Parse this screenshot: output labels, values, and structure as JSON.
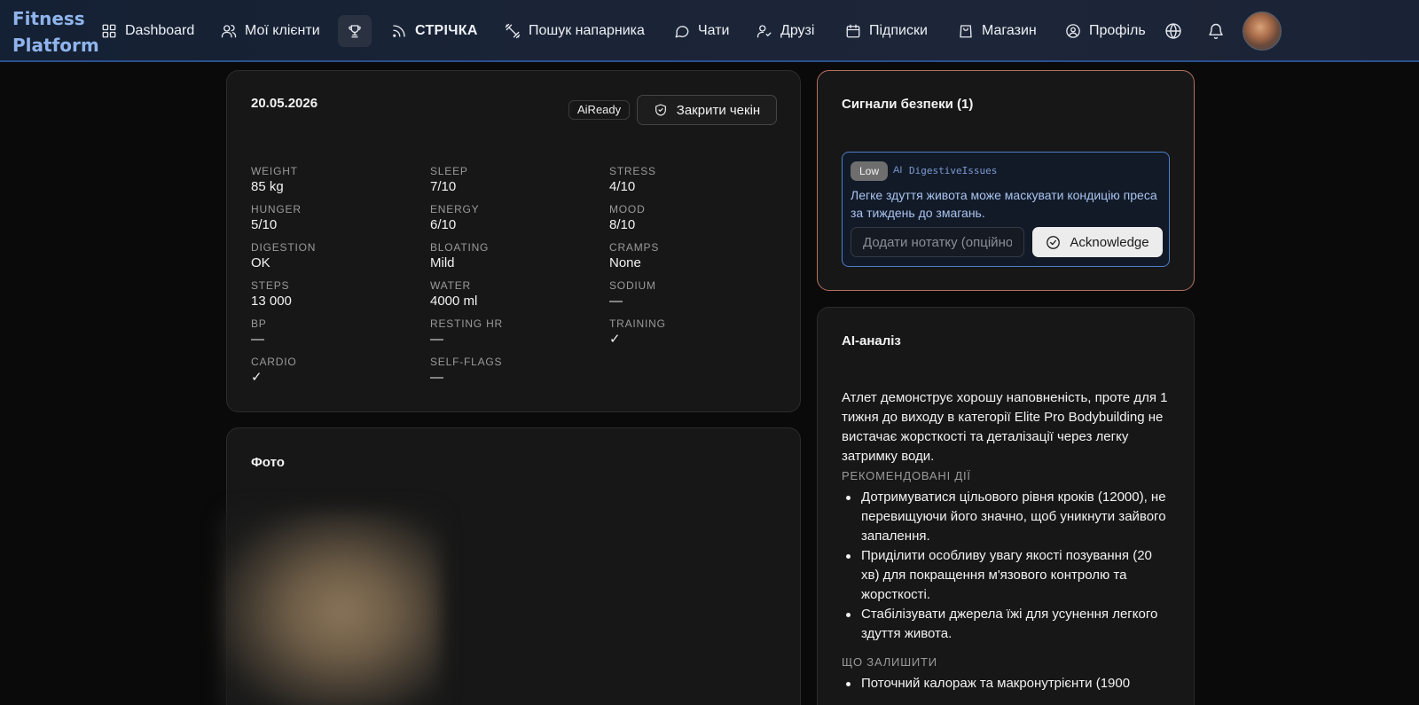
{
  "nav": {
    "brand_line1": "Fitness",
    "brand_line2": "Platform",
    "items": {
      "dashboard": "Dashboard",
      "clients": "Мої клієнти",
      "feed": "СТРІЧКА",
      "partner": "Пошук напарника",
      "chats": "Чати",
      "friends": "Друзі",
      "subscriptions": "Підписки",
      "shop": "Магазин",
      "profile": "Профіль"
    }
  },
  "checkin": {
    "date": "20.05.2026",
    "status_badge": "AiReady",
    "close_label": "Закрити чекін",
    "metrics": {
      "weight": {
        "label": "WEIGHT",
        "value": "85 kg"
      },
      "sleep": {
        "label": "SLEEP",
        "value": "7/10"
      },
      "stress": {
        "label": "STRESS",
        "value": "4/10"
      },
      "hunger": {
        "label": "HUNGER",
        "value": "5/10"
      },
      "energy": {
        "label": "ENERGY",
        "value": "6/10"
      },
      "mood": {
        "label": "MOOD",
        "value": "8/10"
      },
      "digestion": {
        "label": "DIGESTION",
        "value": "OK"
      },
      "bloating": {
        "label": "BLOATING",
        "value": "Mild"
      },
      "cramps": {
        "label": "CRAMPS",
        "value": "None"
      },
      "steps": {
        "label": "STEPS",
        "value": "13 000"
      },
      "water": {
        "label": "WATER",
        "value": "4000 ml"
      },
      "sodium": {
        "label": "SODIUM",
        "value": "—"
      },
      "bp": {
        "label": "BP",
        "value": "—"
      },
      "resting_hr": {
        "label": "RESTING HR",
        "value": "—"
      },
      "training": {
        "label": "TRAINING",
        "value": "✓"
      },
      "cardio": {
        "label": "CARDIO",
        "value": "✓"
      },
      "self_flags": {
        "label": "SELF-FLAGS",
        "value": "—"
      }
    }
  },
  "photos": {
    "title": "Фото"
  },
  "safety": {
    "title": "Сигнали безпеки (1)",
    "signal": {
      "severity": "Low",
      "source": "AI",
      "code": "DigestiveIssues",
      "text": "Легке здуття живота може маскувати кондицію преса за тиждень до змагань.",
      "note_placeholder": "Додати нотатку (опційно)",
      "ack_label": "Acknowledge"
    }
  },
  "ai_analysis": {
    "title": "AI-аналіз",
    "summary": "Атлет демонструє хорошу наповненість, проте для 1 тижня до виходу в категорії Elite Pro Bodybuilding не вистачає жорсткості та деталізації через легку затримку води.",
    "recommended_label": "РЕКОМЕНДОВАНІ ДІЇ",
    "recommended": [
      "Дотримуватися цільового рівня кроків (12000), не перевищуючи його значно, щоб уникнути зайвого запалення.",
      "Приділити особливу увагу якості позування (20 хв) для покращення м'язового контролю та жорсткості.",
      "Стабілізувати джерела їжі для усунення легкого здуття живота."
    ],
    "keep_label": "ЩО ЗАЛИШИТИ",
    "keep": [
      "Поточний калораж та макронутрієнти (1900"
    ]
  }
}
